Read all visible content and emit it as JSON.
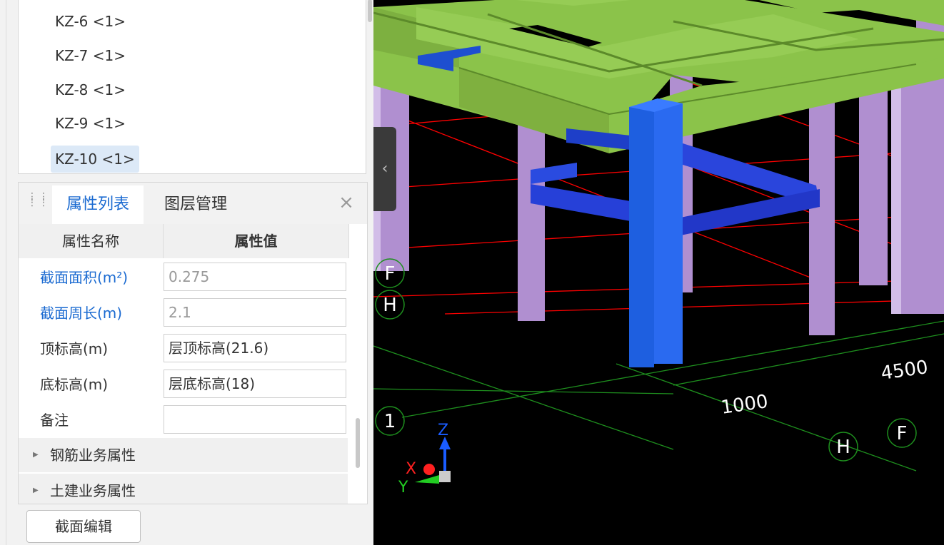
{
  "tree": {
    "items": [
      {
        "label": "KZ-6 <1>"
      },
      {
        "label": "KZ-7 <1>"
      },
      {
        "label": "KZ-8 <1>"
      },
      {
        "label": "KZ-9 <1>"
      },
      {
        "label": "KZ-10 <1>"
      }
    ]
  },
  "panel": {
    "tabs": [
      "属性列表",
      "图层管理"
    ],
    "headers": {
      "name": "属性名称",
      "value": "属性值"
    },
    "rows": [
      {
        "name": "截面面积(m²)",
        "value": "0.275"
      },
      {
        "name": "截面周长(m)",
        "value": "2.1"
      },
      {
        "name": "顶标高(m)",
        "value": "层顶标高(21.6)"
      },
      {
        "name": "底标高(m)",
        "value": "层底标高(18)"
      },
      {
        "name": "备注",
        "value": ""
      }
    ],
    "groups": [
      "钢筋业务属性",
      "土建业务属性"
    ]
  },
  "section_edit_label": "截面编辑",
  "viewport": {
    "axis_labels": [
      "F",
      "H",
      "1",
      "H",
      "F"
    ],
    "dimensions": [
      "4500",
      "1000"
    ],
    "axes": {
      "z": "Z",
      "x": "X",
      "y": "Y"
    }
  },
  "colors": {
    "beam": "#8bc34a",
    "selected_column": "#1e5fe0",
    "column": "#b08fd0",
    "grid_red": "#ff0000",
    "grid_green": "#1e8f1e",
    "accent": "#1a6ad1"
  }
}
